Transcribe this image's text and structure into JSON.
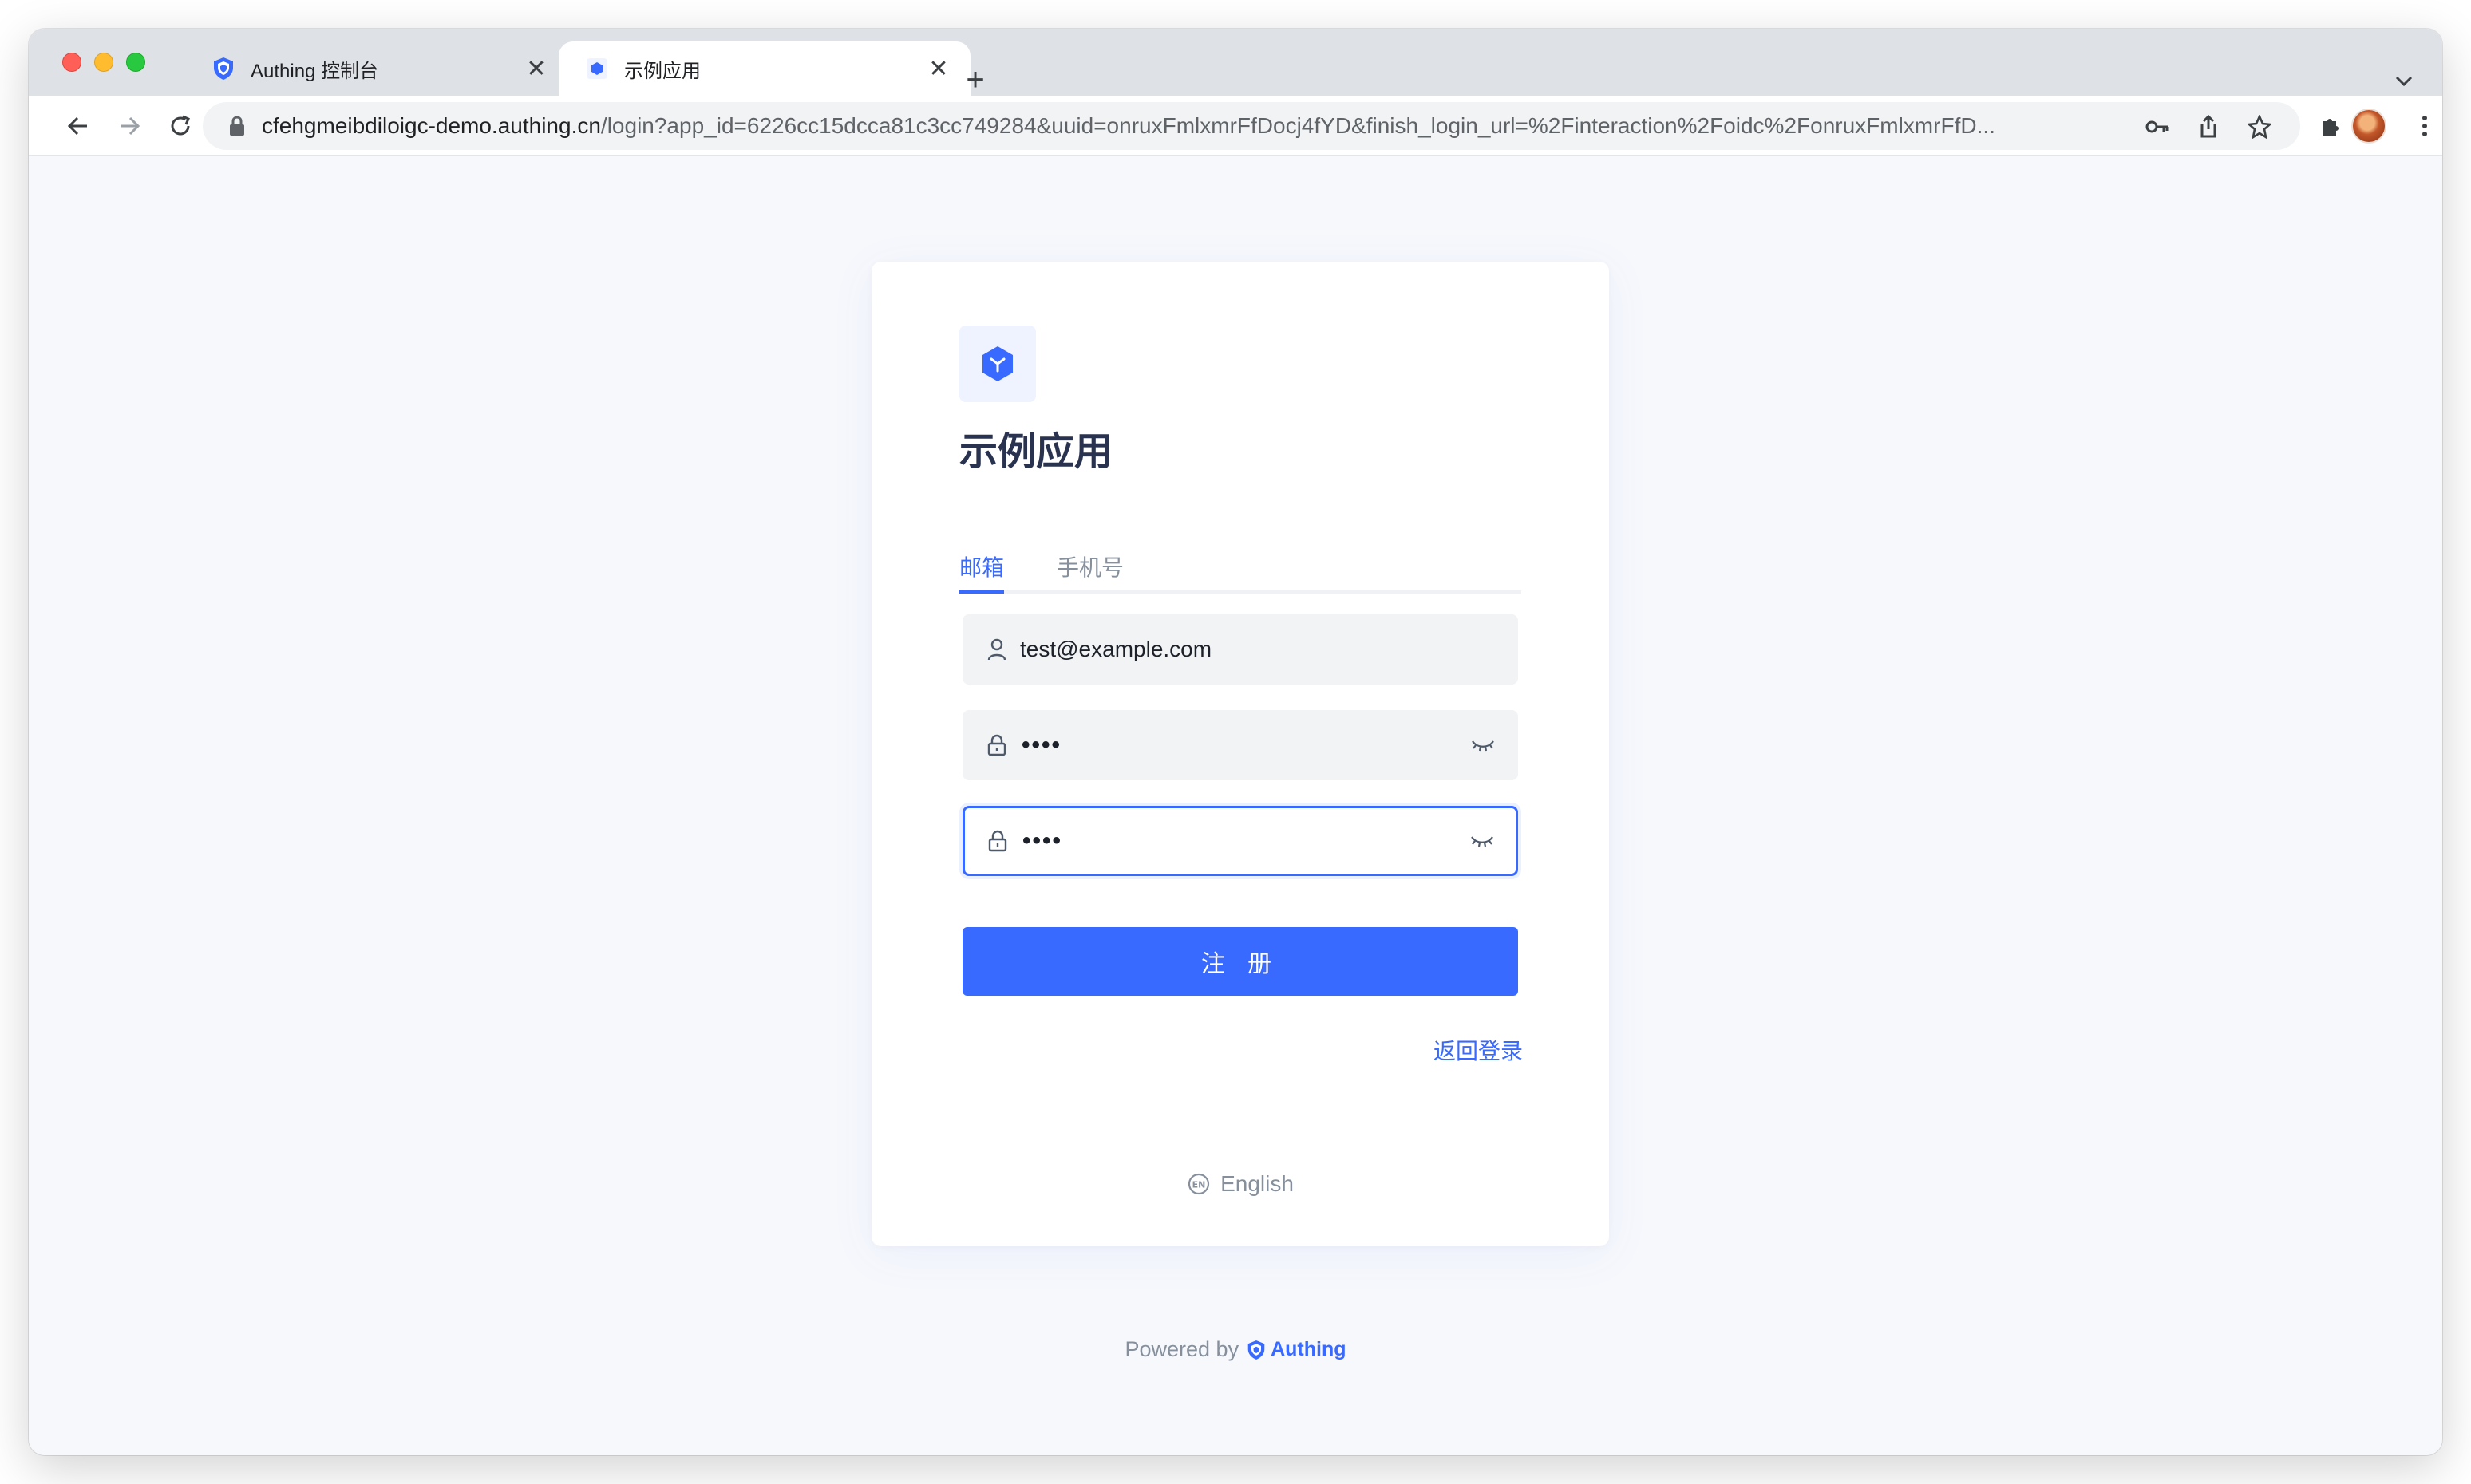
{
  "browser": {
    "tabs": [
      {
        "title": "Authing 控制台",
        "favicon": "authing-shield-icon",
        "active": false
      },
      {
        "title": "示例应用",
        "favicon": "app-cube-icon",
        "active": true
      }
    ],
    "url_host": "cfehgmeibdiloigc-demo.authing.cn",
    "url_path": "/login?app_id=6226cc15dcca81c3cc749284&uuid=onruxFmlxmrFfDocj4fYD&finish_login_url=%2Finteraction%2Foidc%2FonruxFmlxmrFfD..."
  },
  "login": {
    "app_name": "示例应用",
    "tabs": [
      "邮箱",
      "手机号"
    ],
    "active_tab": 0,
    "email_value": "test@example.com",
    "password_value": "••••",
    "confirm_password_value": "••••",
    "submit_label": "注 册",
    "back_to_login": "返回登录",
    "language": "English",
    "language_icon": "en-globe-icon"
  },
  "footer": {
    "powered_by": "Powered by",
    "brand": "Authing"
  },
  "colors": {
    "accent": "#396aff",
    "page_bg": "#f7f8fc",
    "input_bg": "#f2f3f5"
  }
}
